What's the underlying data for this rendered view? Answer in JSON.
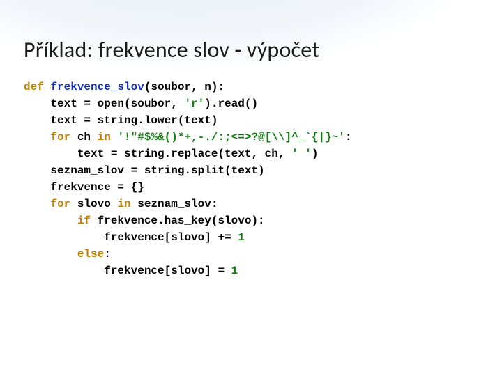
{
  "title": "Příklad: frekvence slov - výpočet",
  "code": {
    "kw_def": "def",
    "fn_name": "frekvence_slov",
    "sig_open": "(soubor, n):",
    "l2_a": "    text = open(soubor, ",
    "l2_str": "'r'",
    "l2_b": ").read()",
    "l3": "    text = string.lower(text)",
    "l4_a": "    ",
    "kw_for1": "for",
    "l4_b": " ch ",
    "kw_in1": "in",
    "l4_c": " ",
    "l4_str": "'!\"#$%&()*+,-./:;<=>?@[\\\\]^_`{|}~'",
    "l4_d": ":",
    "l5_a": "        text = string.replace(text, ch, ",
    "l5_str": "' '",
    "l5_b": ")",
    "l6": "    seznam_slov = string.split(text)",
    "l7": "    frekvence = {}",
    "l8_a": "    ",
    "kw_for2": "for",
    "l8_b": " slovo ",
    "kw_in2": "in",
    "l8_c": " seznam_slov:",
    "l9_a": "        ",
    "kw_if": "if",
    "l9_b": " frekvence.has_key(slovo):",
    "l10_a": "            frekvence[slovo] += ",
    "num1a": "1",
    "l11_a": "        ",
    "kw_else": "else",
    "l11_b": ":",
    "l12_a": "            frekvence[slovo] = ",
    "num1b": "1"
  }
}
